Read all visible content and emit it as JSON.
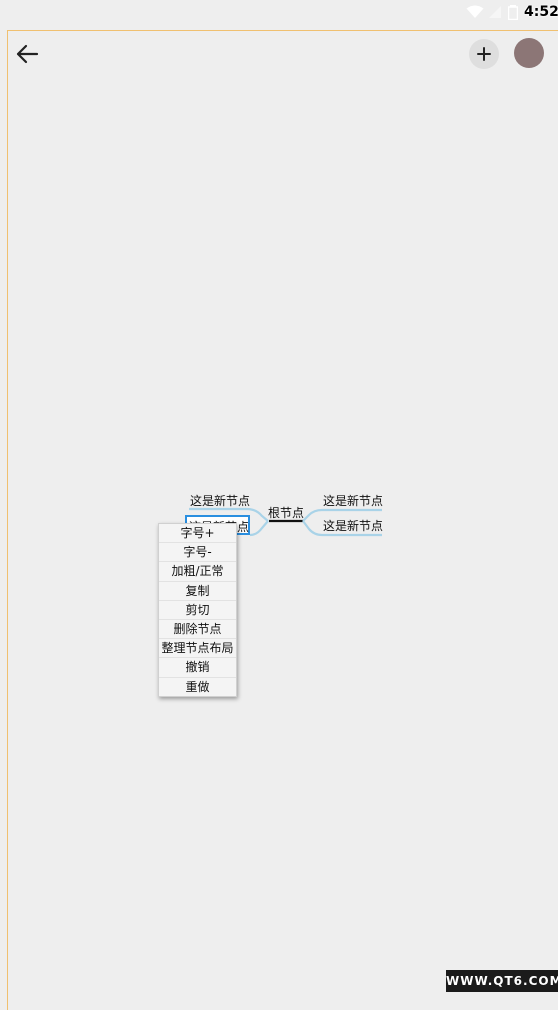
{
  "status_bar": {
    "time": "4:52",
    "wifi_icon": "wifi-icon",
    "signal_icon": "signal-icon",
    "battery_icon": "battery-icon"
  },
  "toolbar": {
    "back_icon": "arrow-left-icon",
    "add_label": "+",
    "avatar_color": "#8c7676"
  },
  "mindmap": {
    "root": "根节点",
    "left_nodes": [
      "这是新节点",
      "这是新节点"
    ],
    "right_nodes": [
      "这是新节点",
      "这是新节点"
    ],
    "branch_color": "#a9d3e8",
    "selected_border_color": "#2a8fe0"
  },
  "context_menu": {
    "items": [
      "字号+",
      "字号-",
      "加粗/正常",
      "复制",
      "剪切",
      "删除节点",
      "整理节点布局",
      "撤销",
      "重做"
    ]
  },
  "watermark": "WWW.QT6.COM"
}
